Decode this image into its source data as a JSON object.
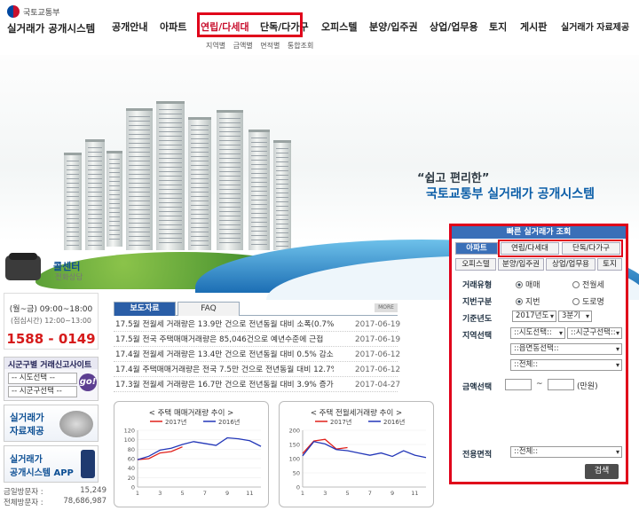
{
  "header": {
    "ministry": "국토교통부",
    "system_name": "실거래가 공개시스템",
    "nav": [
      "공개안내",
      "아파트",
      "연립/다세대",
      "단독/다가구",
      "오피스텔",
      "분양/입주권",
      "상업/업무용",
      "토지",
      "게시판",
      "실거래가 자료제공"
    ],
    "sub_nav": [
      "지역별",
      "금액별",
      "면적별",
      "통합조회"
    ]
  },
  "hero": {
    "slogan": "“쉽고 편리한”",
    "title": "국토교통부 실거래가 공개시스템"
  },
  "call_center": {
    "title": "콜센터",
    "subtitle": "전화상담",
    "hours": "(월~금) 09:00~18:00",
    "lunch": "(점심시간) 12:00~13:00",
    "phone": "1588 - 0149"
  },
  "region_sites": {
    "title": "시군구별 거래신고사이트",
    "sido": "-- 시도선택 --",
    "sigungu": "-- 시군구선택 --",
    "go": "go!"
  },
  "promos": {
    "data_service": "실거래가\n자료제공",
    "app": "실거래가\n공개시스템 APP"
  },
  "visitors": {
    "today_label": "금일방문자 :",
    "today": "15,249",
    "total_label": "전체방문자 :",
    "total": "78,686,987"
  },
  "news": {
    "tabs": [
      "보도자료",
      "FAQ"
    ],
    "more": "MORE",
    "items": [
      {
        "title": "17.5월 전월세 거래량은 13.9만 건으로 전년동월 대비 소폭(0.7%) 증가",
        "date": "2017-06-19"
      },
      {
        "title": "17.5월 전국 주택매매거래량은 85,046건으로 예년수준에 근접",
        "date": "2017-06-19"
      },
      {
        "title": "17.4월 전월세 거래량은 13.4만 건으로 전년동월 대비 0.5% 감소",
        "date": "2017-06-12"
      },
      {
        "title": "17.4월 주택매매거래량은 전국 7.5만 건으로 전년동월 대비 12.7% 감소",
        "date": "2017-06-12"
      },
      {
        "title": "17.3월 전월세 거래량은 16.7만 건으로 전년동월 대비 3.9% 증가",
        "date": "2017-04-27"
      }
    ]
  },
  "charts": {
    "left_title": "< 주택 매매거래량 추이 >",
    "right_title": "< 주택 전월세거래량 추이 >"
  },
  "chart_data": [
    {
      "type": "line",
      "title": "< 주택 매매거래량 추이 >",
      "x": [
        1,
        2,
        3,
        4,
        5,
        6,
        7,
        8,
        9,
        10,
        11,
        12
      ],
      "xticks": [
        "1",
        "3",
        "5",
        "7",
        "9",
        "11"
      ],
      "ylim": [
        0,
        120
      ],
      "yticks": [
        "0",
        "20",
        "40",
        "60",
        "80",
        "100",
        "120"
      ],
      "series": [
        {
          "name": "2017년",
          "color": "#e0201a",
          "values": [
            58,
            60,
            72,
            75,
            85
          ]
        },
        {
          "name": "2016년",
          "color": "#2236b8",
          "values": [
            58,
            65,
            78,
            82,
            90,
            96,
            92,
            88,
            104,
            102,
            98,
            86
          ]
        }
      ]
    },
    {
      "type": "line",
      "title": "< 주택 전월세거래량 추이 >",
      "x": [
        1,
        2,
        3,
        4,
        5,
        6,
        7,
        8,
        9,
        10,
        11,
        12
      ],
      "xticks": [
        "1",
        "3",
        "5",
        "7",
        "9",
        "11"
      ],
      "ylim": [
        0,
        200
      ],
      "yticks": [
        "0",
        "50",
        "100",
        "150",
        "200"
      ],
      "series": [
        {
          "name": "2017년",
          "color": "#e0201a",
          "values": [
            118,
            162,
            168,
            134,
            139
          ]
        },
        {
          "name": "2016년",
          "color": "#2236b8",
          "values": [
            110,
            160,
            152,
            132,
            128,
            120,
            112,
            120,
            108,
            128,
            112,
            104
          ]
        }
      ]
    }
  ],
  "quick_search": {
    "title": "빠른 실거래가 조회",
    "tabs_row1": [
      "아파트",
      "연립/다세대",
      "단독/다가구"
    ],
    "tabs_row2": [
      "오피스텔",
      "분양/입주권",
      "상업/업무용",
      "토지"
    ],
    "trade_type_label": "거래유형",
    "trade_types": [
      "매매",
      "전월세"
    ],
    "addr_type_label": "지번구분",
    "addr_types": [
      "지번",
      "도로명"
    ],
    "year_label": "기준년도",
    "year": "2017년도",
    "quarter": "3분기",
    "region_label": "지역선택",
    "sido": "::시도선택::",
    "sigungu": "::시군구선택::",
    "dong": "::읍면동선택::",
    "all": "::전체::",
    "price_label": "금액선택",
    "price_sep": "~",
    "price_unit": "(만원)",
    "area_label": "전용면적",
    "area": "::전체::",
    "search": "검색"
  }
}
